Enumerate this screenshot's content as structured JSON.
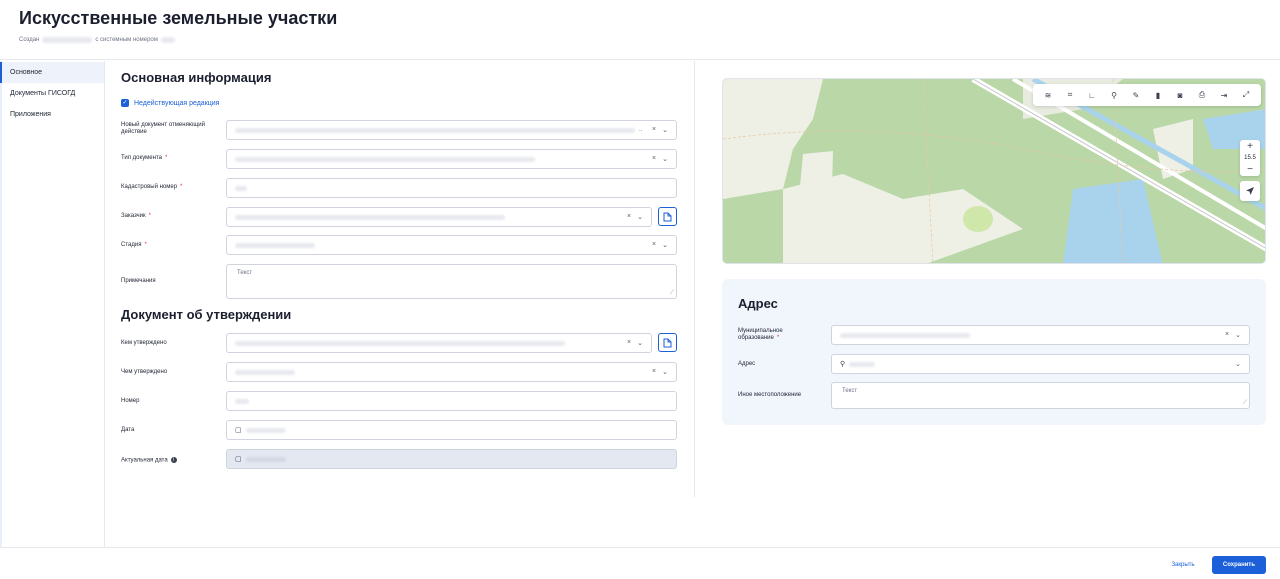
{
  "page": {
    "title": "Искусственные земельные участки",
    "created_prefix": "Создан",
    "created_suffix": "с системным номером"
  },
  "sidebar": {
    "items": [
      {
        "label": "Основное",
        "active": true
      },
      {
        "label": "Документы ГИСОГД",
        "active": false
      },
      {
        "label": "Приложения",
        "active": false
      }
    ]
  },
  "main_info": {
    "title": "Основная информация",
    "inactive_checkbox_label": "Недействующая редакция",
    "inactive_checked": true,
    "fields": {
      "cancel_doc_label": "Новый документ отменяющий действие",
      "doc_type_label": "Тип документа",
      "cadastral_label": "Кадастровый номер",
      "customer_label": "Заказчик",
      "stage_label": "Стадия",
      "notes_label": "Примечания",
      "notes_placeholder": "Текст"
    }
  },
  "approval": {
    "title": "Документ об утверждении",
    "approved_by_label": "Кем утверждено",
    "approved_with_label": "Чем утверждено",
    "number_label": "Номер",
    "date_label": "Дата",
    "actual_date_label": "Актуальная дата"
  },
  "map": {
    "zoom_level": "15.5",
    "zoom_in": "+",
    "zoom_out": "−",
    "tools": [
      "layers-icon",
      "select-area-icon",
      "measure-icon",
      "search-icon",
      "edit-icon",
      "delete-icon",
      "camera-icon",
      "import-icon",
      "export-icon",
      "fullscreen-icon"
    ]
  },
  "address": {
    "title": "Адрес",
    "municipal_label": "Муниципальное образование",
    "address_label": "Адрес",
    "other_location_label": "Иное местоположение",
    "other_location_placeholder": "Текст"
  },
  "footer": {
    "close_label": "Закрыть",
    "save_label": "Сохранить"
  },
  "colors": {
    "accent": "#1b5fd9",
    "required": "#e0334f",
    "map_green": "#b9d7a7",
    "map_water": "#a9d3ec"
  }
}
